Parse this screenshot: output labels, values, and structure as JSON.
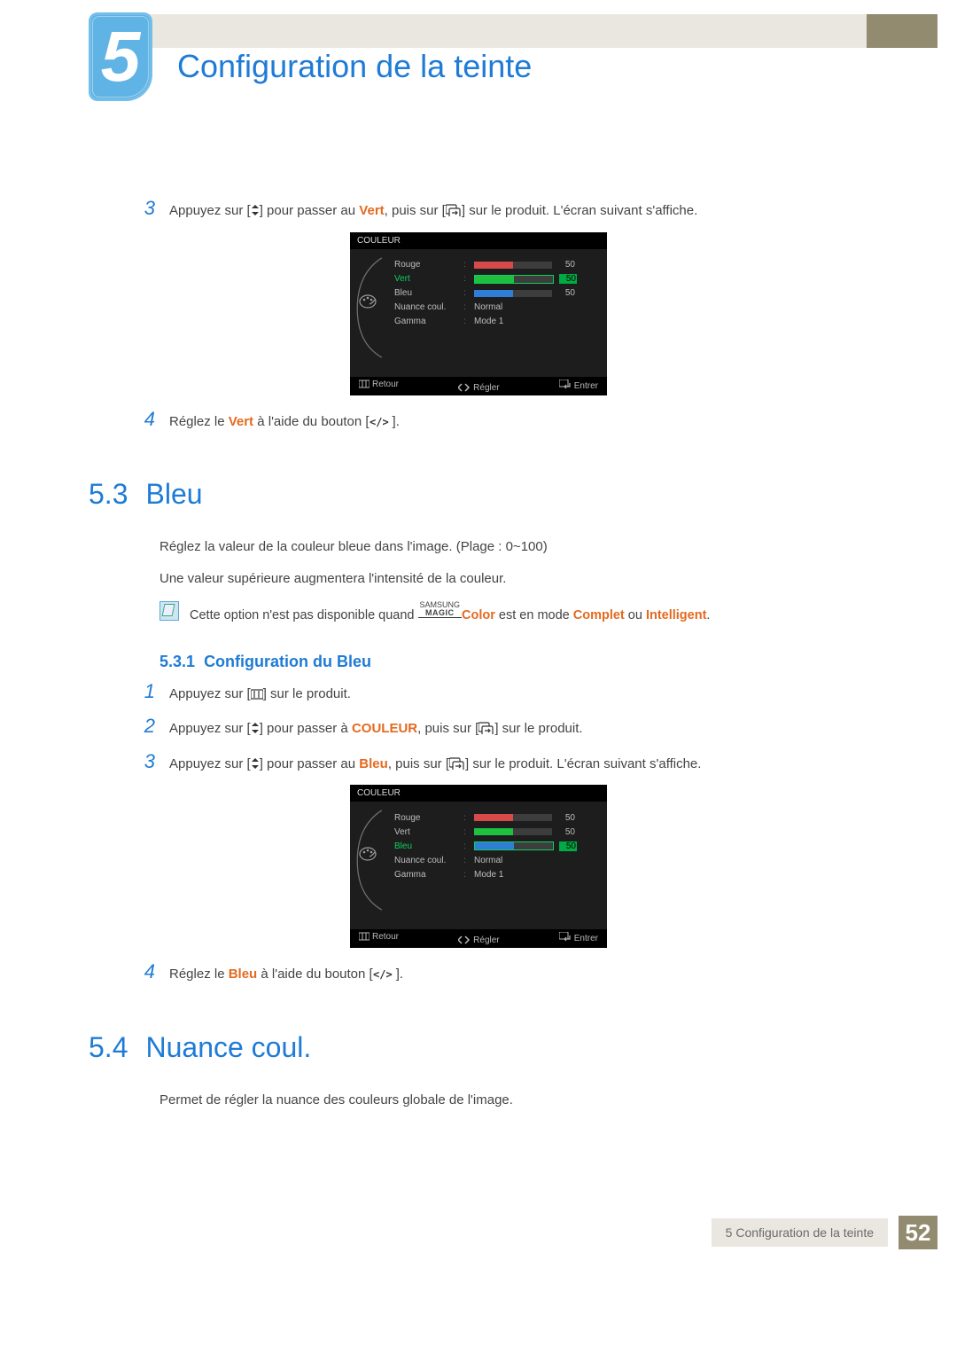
{
  "chapter": {
    "number": "5",
    "title": "Configuration de la teinte"
  },
  "osd": {
    "title": "COULEUR",
    "rows": {
      "rouge": "Rouge",
      "vert": "Vert",
      "bleu": "Bleu",
      "nuance": "Nuance coul.",
      "gamma": "Gamma",
      "nuance_val": "Normal",
      "gamma_val": "Mode 1",
      "val": "50"
    },
    "footer": {
      "retour": "Retour",
      "regler": "Régler",
      "entrer": "Entrer"
    }
  },
  "colors": {
    "rouge": "#d64a4a",
    "vert": "#1fbf3f",
    "bleu": "#2e7dd6",
    "sel": "#0fcf5d"
  },
  "step3_top": {
    "num": "3",
    "pre": "Appuyez sur [",
    "mid1": "] pour passer au ",
    "highlight": "Vert",
    "mid2": ", puis sur [",
    "post": "] sur le produit. L'écran suivant s'affiche."
  },
  "step4_top": {
    "num": "4",
    "pre": "Réglez le ",
    "highlight": "Vert",
    "mid": " à l'aide du bouton [",
    "post": "]."
  },
  "sec53": {
    "num": "5.3",
    "title": "Bleu",
    "p1": "Réglez la valeur de la couleur bleue dans l'image. (Plage : 0~100)",
    "p2": "Une valeur supérieure augmentera l'intensité de la couleur.",
    "note_pre": "Cette option n'est pas disponible quand ",
    "magic_top": "SAMSUNG",
    "magic_bot": "MAGIC",
    "note_color": "Color",
    "note_mid": " est en mode ",
    "note_complet": "Complet",
    "note_ou": " ou ",
    "note_intelligent": "Intelligent",
    "note_end": ".",
    "sub_num": "5.3.1",
    "sub_title": "Configuration du Bleu"
  },
  "steps_bleu": {
    "s1": {
      "num": "1",
      "pre": "Appuyez sur [",
      "post": "] sur le produit."
    },
    "s2": {
      "num": "2",
      "pre": "Appuyez sur [",
      "mid1": "] pour passer à ",
      "highlight": "COULEUR",
      "mid2": ", puis sur [",
      "post": "] sur le produit."
    },
    "s3": {
      "num": "3",
      "pre": "Appuyez sur [",
      "mid1": "] pour passer au ",
      "highlight": "Bleu",
      "mid2": ", puis sur [",
      "post": "] sur le produit. L'écran suivant s'affiche."
    },
    "s4": {
      "num": "4",
      "pre": "Réglez le ",
      "highlight": "Bleu",
      "mid": " à l'aide du bouton [",
      "post": "]."
    }
  },
  "sec54": {
    "num": "5.4",
    "title": "Nuance coul.",
    "p1": "Permet de régler la nuance des couleurs globale de l'image."
  },
  "footer": {
    "text": "5 Configuration de la teinte",
    "page": "52"
  },
  "chart_data": [
    {
      "type": "bar",
      "categories": [
        "Rouge",
        "Vert",
        "Bleu"
      ],
      "values": [
        50,
        50,
        50
      ],
      "title": "COULEUR (Vert sélectionné)",
      "ylim": [
        0,
        100
      ],
      "selected": "Vert",
      "extra": {
        "Nuance coul.": "Normal",
        "Gamma": "Mode 1"
      }
    },
    {
      "type": "bar",
      "categories": [
        "Rouge",
        "Vert",
        "Bleu"
      ],
      "values": [
        50,
        50,
        50
      ],
      "title": "COULEUR (Bleu sélectionné)",
      "ylim": [
        0,
        100
      ],
      "selected": "Bleu",
      "extra": {
        "Nuance coul.": "Normal",
        "Gamma": "Mode 1"
      }
    }
  ]
}
